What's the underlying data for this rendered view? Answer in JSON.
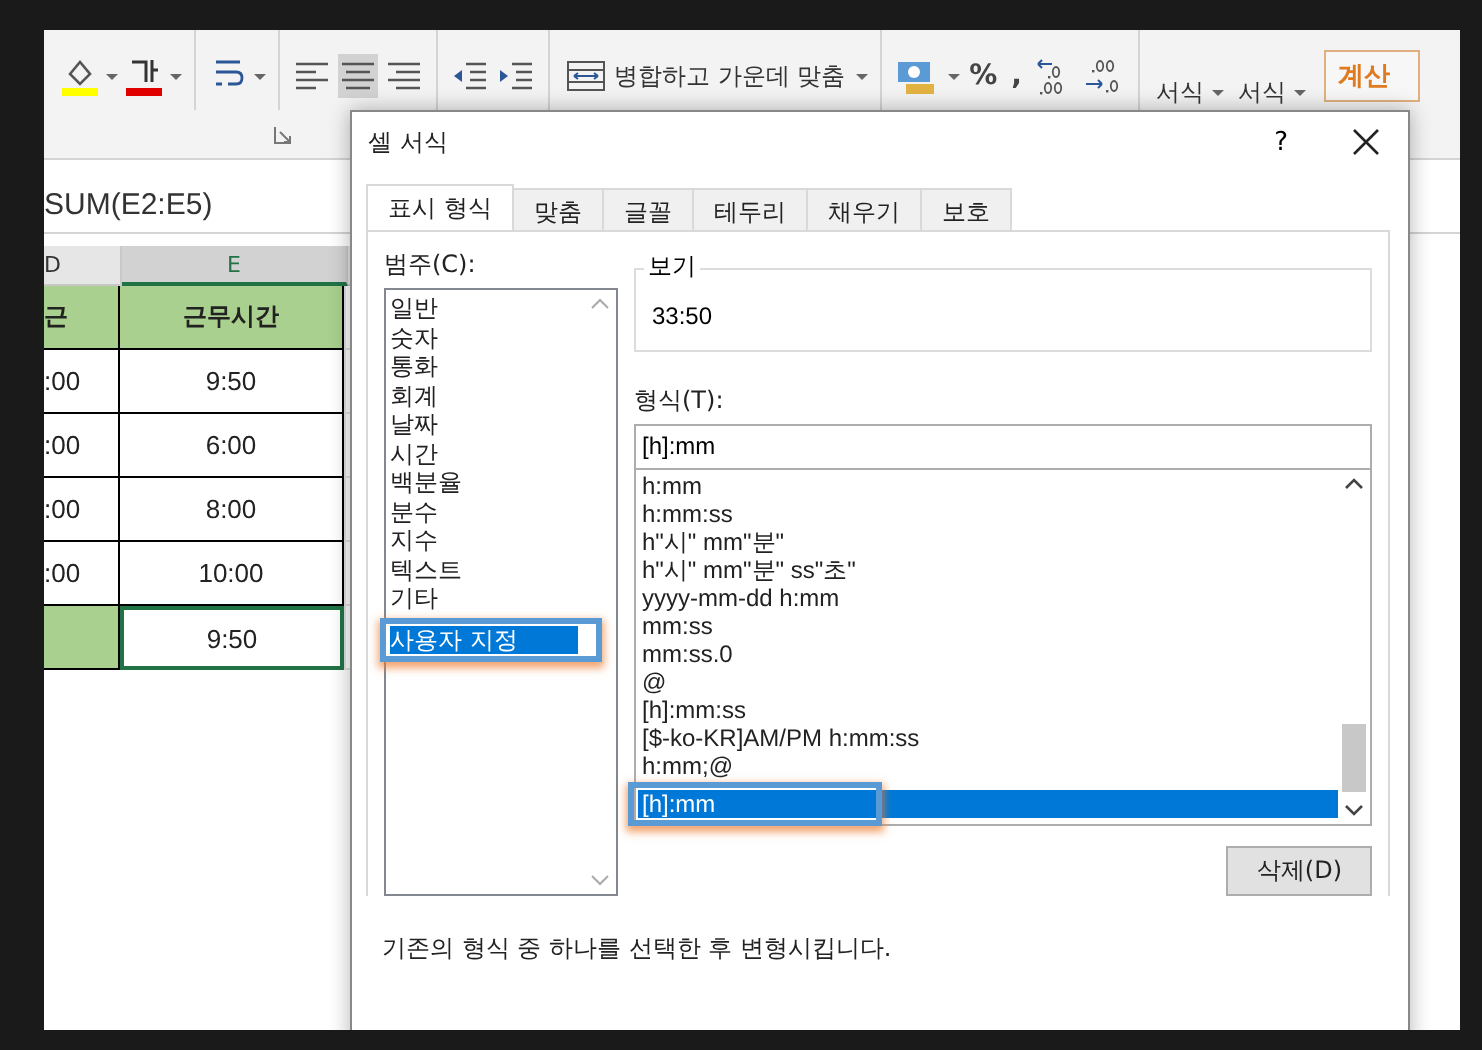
{
  "ribbon": {
    "merge_label": "병합하고 가운데 맞춤",
    "percent": "%",
    "comma": ",",
    "format_buttons": [
      "서식",
      "서식"
    ],
    "cell_style": "계산"
  },
  "formula_bar": {
    "formula": "SUM(E2:E5)"
  },
  "sheet": {
    "columns": [
      {
        "label": "D",
        "selected": false
      },
      {
        "label": "E",
        "selected": true
      }
    ],
    "rows": [
      {
        "kind": "header",
        "cells": [
          "근",
          "근무시간"
        ]
      },
      {
        "kind": "data",
        "cells": [
          ":00",
          "9:50"
        ]
      },
      {
        "kind": "data",
        "cells": [
          ":00",
          "6:00"
        ]
      },
      {
        "kind": "data",
        "cells": [
          ":00",
          "8:00"
        ]
      },
      {
        "kind": "data",
        "cells": [
          ":00",
          "10:00"
        ]
      },
      {
        "kind": "total",
        "cells": [
          "",
          "9:50"
        ]
      }
    ]
  },
  "dialog": {
    "title": "셀 서식",
    "help": "?",
    "tabs": [
      {
        "label": "표시 형식",
        "selected": true
      },
      {
        "label": "맞춤",
        "selected": false
      },
      {
        "label": "글꼴",
        "selected": false
      },
      {
        "label": "테두리",
        "selected": false
      },
      {
        "label": "채우기",
        "selected": false
      },
      {
        "label": "보호",
        "selected": false
      }
    ],
    "category_label": "범주(C):",
    "categories": [
      {
        "label": "일반",
        "selected": false
      },
      {
        "label": "숫자",
        "selected": false
      },
      {
        "label": "통화",
        "selected": false
      },
      {
        "label": "회계",
        "selected": false
      },
      {
        "label": "날짜",
        "selected": false
      },
      {
        "label": "시간",
        "selected": false
      },
      {
        "label": "백분율",
        "selected": false
      },
      {
        "label": "분수",
        "selected": false
      },
      {
        "label": "지수",
        "selected": false
      },
      {
        "label": "텍스트",
        "selected": false
      },
      {
        "label": "기타",
        "selected": false
      },
      {
        "label": "사용자 지정",
        "selected": true
      }
    ],
    "sample_label": "보기",
    "sample_value": "33:50",
    "type_label": "형식(T):",
    "type_value": "[h]:mm",
    "types": [
      {
        "label": "h:mm",
        "selected": false
      },
      {
        "label": "h:mm:ss",
        "selected": false
      },
      {
        "label": "h\"시\" mm\"분\"",
        "selected": false
      },
      {
        "label": "h\"시\" mm\"분\" ss\"초\"",
        "selected": false
      },
      {
        "label": "yyyy-mm-dd h:mm",
        "selected": false
      },
      {
        "label": "mm:ss",
        "selected": false
      },
      {
        "label": "mm:ss.0",
        "selected": false
      },
      {
        "label": "@",
        "selected": false
      },
      {
        "label": "[h]:mm:ss",
        "selected": false
      },
      {
        "label": "[$-ko-KR]AM/PM h:mm:ss",
        "selected": false
      },
      {
        "label": "h:mm;@",
        "selected": false
      },
      {
        "label": "[h]:mm",
        "selected": true
      }
    ],
    "delete_button": "삭제(D)",
    "description": "기존의 형식 중 하나를 선택한 후 변형시킵니다."
  }
}
